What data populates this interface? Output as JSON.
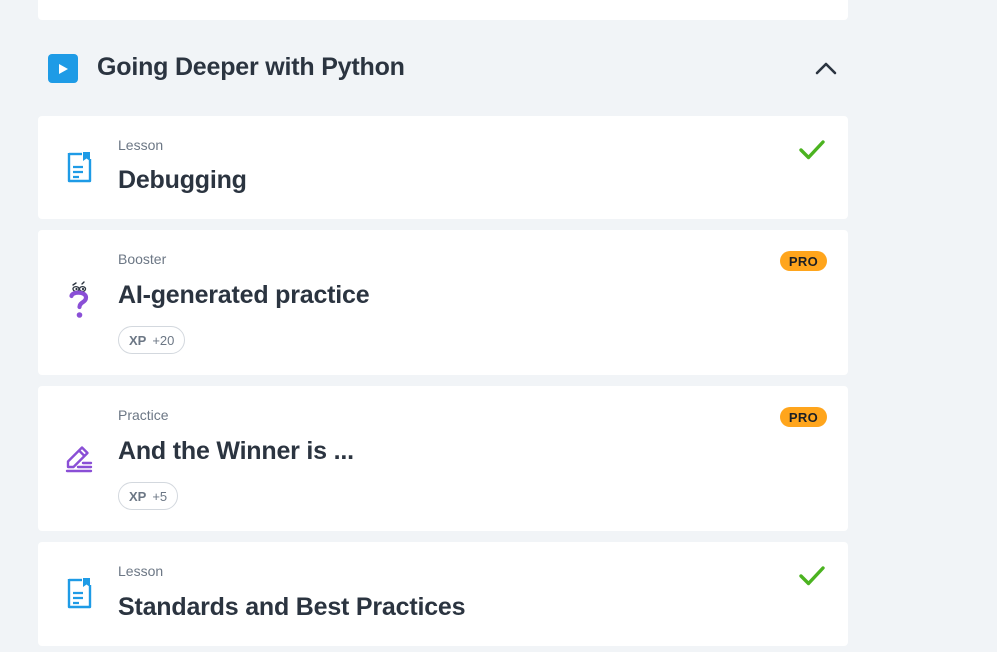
{
  "module": {
    "title": "Going Deeper with Python",
    "icon": "play-icon",
    "accent": "#1e9be6",
    "collapse_icon": "chevron-up-icon"
  },
  "items": [
    {
      "type": "Lesson",
      "title": "Debugging",
      "icon": "lesson-document-icon",
      "status": "completed"
    },
    {
      "type": "Booster",
      "title": "AI-generated practice",
      "icon": "question-mark-icon",
      "badge": "PRO",
      "xp_label": "XP",
      "xp_value": "+20"
    },
    {
      "type": "Practice",
      "title": "And the Winner is ...",
      "icon": "pencil-edit-icon",
      "badge": "PRO",
      "xp_label": "XP",
      "xp_value": "+5"
    },
    {
      "type": "Lesson",
      "title": "Standards and Best Practices",
      "icon": "lesson-document-icon",
      "status": "completed"
    }
  ],
  "colors": {
    "background": "#f1f4f7",
    "card": "#ffffff",
    "check": "#4bb320",
    "pro_badge": "#ffa51c",
    "booster_purple": "#8a4fd6",
    "lesson_blue": "#1e9be6"
  }
}
